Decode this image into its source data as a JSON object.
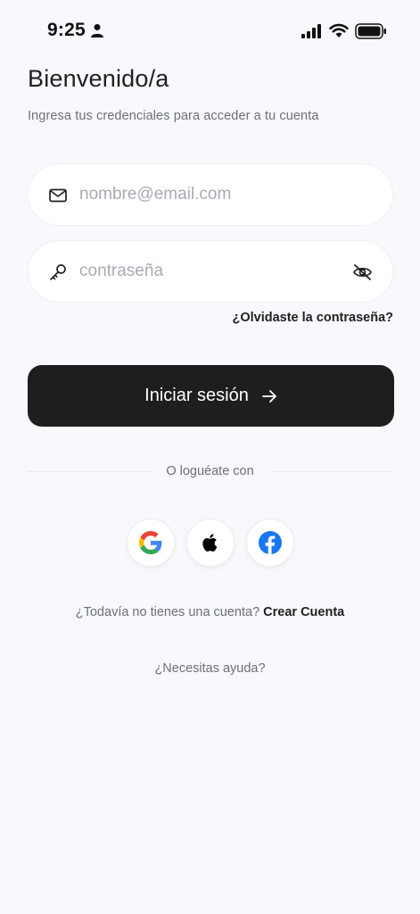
{
  "status_bar": {
    "time": "9:25"
  },
  "header": {
    "title": "Bienvenido/a",
    "subtitle": "Ingresa tus credenciales para acceder a tu cuenta"
  },
  "form": {
    "email_placeholder": "nombre@email.com",
    "email_value": "",
    "password_placeholder": "contraseña",
    "password_value": "",
    "forgot_label": "¿Olvidaste la contraseña?",
    "login_label": "Iniciar sesión"
  },
  "divider": {
    "label": "O loguéate con"
  },
  "social": [
    {
      "name": "google-icon"
    },
    {
      "name": "apple-icon"
    },
    {
      "name": "facebook-icon"
    }
  ],
  "signup": {
    "prompt": "¿Todavía no tienes una cuenta?",
    "link": "Crear Cuenta"
  },
  "help": {
    "label": "¿Necesitas ayuda?"
  },
  "colors": {
    "background": "#f8f9fd",
    "primary_button": "#1e1e1e",
    "google_blue": "#4285F4",
    "facebook_blue": "#1877F2"
  }
}
